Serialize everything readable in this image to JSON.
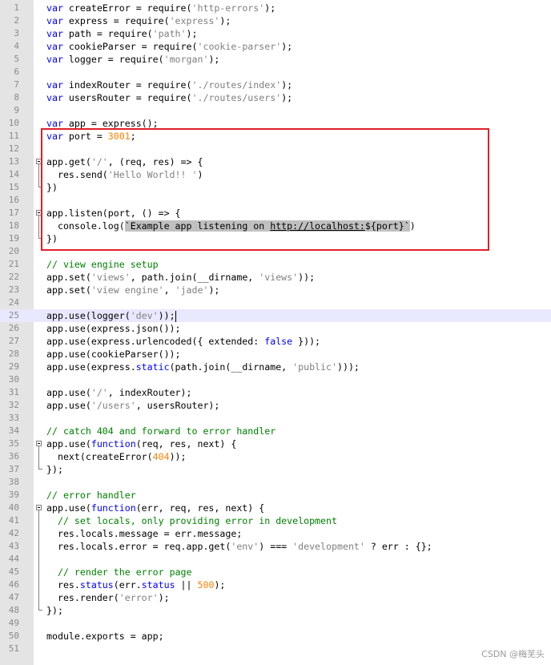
{
  "editor": {
    "current_line": 25,
    "lines": [
      [
        {
          "t": "var",
          "c": "kw"
        },
        {
          "t": " createError = require("
        },
        {
          "t": "'http-errors'",
          "c": "str"
        },
        {
          "t": ");"
        }
      ],
      [
        {
          "t": "var",
          "c": "kw"
        },
        {
          "t": " express = require("
        },
        {
          "t": "'express'",
          "c": "str"
        },
        {
          "t": ");"
        }
      ],
      [
        {
          "t": "var",
          "c": "kw"
        },
        {
          "t": " path = require("
        },
        {
          "t": "'path'",
          "c": "str"
        },
        {
          "t": ");"
        }
      ],
      [
        {
          "t": "var",
          "c": "kw"
        },
        {
          "t": " cookieParser = require("
        },
        {
          "t": "'cookie-parser'",
          "c": "str"
        },
        {
          "t": ");"
        }
      ],
      [
        {
          "t": "var",
          "c": "kw"
        },
        {
          "t": " logger = require("
        },
        {
          "t": "'morgan'",
          "c": "str"
        },
        {
          "t": ");"
        }
      ],
      [],
      [
        {
          "t": "var",
          "c": "kw"
        },
        {
          "t": " indexRouter = require("
        },
        {
          "t": "'./routes/index'",
          "c": "str"
        },
        {
          "t": ");"
        }
      ],
      [
        {
          "t": "var",
          "c": "kw"
        },
        {
          "t": " usersRouter = require("
        },
        {
          "t": "'./routes/users'",
          "c": "str"
        },
        {
          "t": ");"
        }
      ],
      [],
      [
        {
          "t": "var",
          "c": "kw"
        },
        {
          "t": " app = express();"
        }
      ],
      [
        {
          "t": "var",
          "c": "kw"
        },
        {
          "t": " port = "
        },
        {
          "t": "3001",
          "c": "num"
        },
        {
          "t": ";"
        }
      ],
      [],
      [
        {
          "t": "app.get("
        },
        {
          "t": "'/'",
          "c": "str"
        },
        {
          "t": ", (req, res) => {"
        }
      ],
      [
        {
          "t": "  res.send("
        },
        {
          "t": "'Hello World!! '",
          "c": "str"
        },
        {
          "t": ")"
        }
      ],
      [
        {
          "t": "})"
        }
      ],
      [],
      [
        {
          "t": "app.listen(port, () => {"
        }
      ],
      [
        {
          "t": "  console.log("
        },
        {
          "t": "`Example app listening on ",
          "c": "hl"
        },
        {
          "t": "http://localhost:",
          "c": "hl url"
        },
        {
          "t": "${port}`",
          "c": "hl"
        },
        {
          "t": ")"
        }
      ],
      [
        {
          "t": "})"
        }
      ],
      [],
      [
        {
          "t": "// view engine setup",
          "c": "com"
        }
      ],
      [
        {
          "t": "app.set("
        },
        {
          "t": "'views'",
          "c": "str"
        },
        {
          "t": ", path.join(__dirname, "
        },
        {
          "t": "'views'",
          "c": "str"
        },
        {
          "t": "));"
        }
      ],
      [
        {
          "t": "app.set("
        },
        {
          "t": "'view engine'",
          "c": "str"
        },
        {
          "t": ", "
        },
        {
          "t": "'jade'",
          "c": "str"
        },
        {
          "t": ");"
        }
      ],
      [],
      [
        {
          "t": "app.use(logger("
        },
        {
          "t": "'dev'",
          "c": "str"
        },
        {
          "t": "));"
        },
        {
          "t": "",
          "c": "caret"
        }
      ],
      [
        {
          "t": "app.use(express.json());"
        }
      ],
      [
        {
          "t": "app.use(express.urlencoded({ extended: "
        },
        {
          "t": "false",
          "c": "kw"
        },
        {
          "t": " }));"
        }
      ],
      [
        {
          "t": "app.use(cookieParser());"
        }
      ],
      [
        {
          "t": "app.use(express."
        },
        {
          "t": "static",
          "c": "fn"
        },
        {
          "t": "(path.join(__dirname, "
        },
        {
          "t": "'public'",
          "c": "str"
        },
        {
          "t": ")));"
        }
      ],
      [],
      [
        {
          "t": "app.use("
        },
        {
          "t": "'/'",
          "c": "str"
        },
        {
          "t": ", indexRouter);"
        }
      ],
      [
        {
          "t": "app.use("
        },
        {
          "t": "'/users'",
          "c": "str"
        },
        {
          "t": ", usersRouter);"
        }
      ],
      [],
      [
        {
          "t": "// catch 404 and forward to error handler",
          "c": "com"
        }
      ],
      [
        {
          "t": "app.use("
        },
        {
          "t": "function",
          "c": "kw"
        },
        {
          "t": "(req, res, next) {"
        }
      ],
      [
        {
          "t": "  next(createError("
        },
        {
          "t": "404",
          "c": "num"
        },
        {
          "t": "));"
        }
      ],
      [
        {
          "t": "});"
        }
      ],
      [],
      [
        {
          "t": "// error handler",
          "c": "com"
        }
      ],
      [
        {
          "t": "app.use("
        },
        {
          "t": "function",
          "c": "kw"
        },
        {
          "t": "(err, req, res, next) {"
        }
      ],
      [
        {
          "t": "  "
        },
        {
          "t": "// set locals, only providing error in development",
          "c": "com"
        }
      ],
      [
        {
          "t": "  res.locals.message = err.message;"
        }
      ],
      [
        {
          "t": "  res.locals.error = req.app.get("
        },
        {
          "t": "'env'",
          "c": "str"
        },
        {
          "t": ") === "
        },
        {
          "t": "'development'",
          "c": "str"
        },
        {
          "t": " ? err : {};"
        }
      ],
      [],
      [
        {
          "t": "  "
        },
        {
          "t": "// render the error page",
          "c": "com"
        }
      ],
      [
        {
          "t": "  res."
        },
        {
          "t": "status",
          "c": "fn"
        },
        {
          "t": "(err."
        },
        {
          "t": "status",
          "c": "fn"
        },
        {
          "t": " || "
        },
        {
          "t": "500",
          "c": "num"
        },
        {
          "t": ");"
        }
      ],
      [
        {
          "t": "  res.render("
        },
        {
          "t": "'error'",
          "c": "str"
        },
        {
          "t": ");"
        }
      ],
      [
        {
          "t": "});"
        }
      ],
      [],
      [
        {
          "t": "module.exports = app;"
        }
      ],
      []
    ]
  },
  "folds": [
    {
      "start": 13,
      "end": 15
    },
    {
      "start": 17,
      "end": 19
    },
    {
      "start": 35,
      "end": 37
    },
    {
      "start": 40,
      "end": 48
    }
  ],
  "watermark": "CSDN @梅芜头",
  "colors": {
    "keyword": "#0000ff",
    "string": "#808080",
    "number": "#ff8000",
    "comment": "#008000",
    "annotation_box": "#e0202a"
  }
}
